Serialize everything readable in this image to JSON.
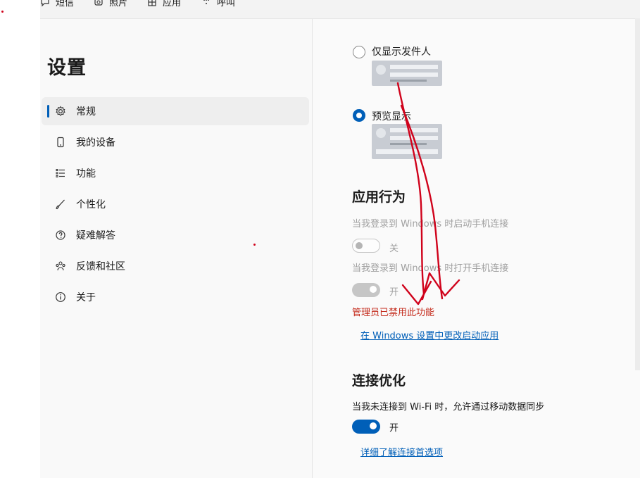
{
  "topnav": {
    "items": [
      {
        "label": "短信",
        "icon": "message-icon"
      },
      {
        "label": "照片",
        "icon": "photo-icon"
      },
      {
        "label": "应用",
        "icon": "apps-icon"
      },
      {
        "label": "呼叫",
        "icon": "dialpad-icon"
      }
    ]
  },
  "settings": {
    "title": "设置",
    "nav": [
      {
        "label": "常规",
        "icon": "gear-icon",
        "active": true
      },
      {
        "label": "我的设备",
        "icon": "phone-icon"
      },
      {
        "label": "功能",
        "icon": "list-icon"
      },
      {
        "label": "个性化",
        "icon": "brush-icon"
      },
      {
        "label": "疑难解答",
        "icon": "help-icon"
      },
      {
        "label": "反馈和社区",
        "icon": "community-icon"
      },
      {
        "label": "关于",
        "icon": "info-icon"
      }
    ]
  },
  "notifications": {
    "option_sender_only": "仅显示发件人",
    "option_preview": "预览显示",
    "selected": "预览显示"
  },
  "app_behavior": {
    "heading": "应用行为",
    "startup_desc": "当我登录到 Windows 时启动手机连接",
    "startup_state": "关",
    "open_desc": "当我登录到 Windows 时打开手机连接",
    "open_state": "开",
    "admin_error": "管理员已禁用此功能",
    "startup_link": "在 Windows 设置中更改启动应用"
  },
  "connection": {
    "heading": "连接优化",
    "desc": "当我未连接到 Wi-Fi 时，允许通过移动数据同步",
    "state": "开",
    "link": "详细了解连接首选项"
  },
  "colors": {
    "accent": "#005fb8",
    "error": "#c42b1c",
    "annotation": "#d0021b"
  }
}
